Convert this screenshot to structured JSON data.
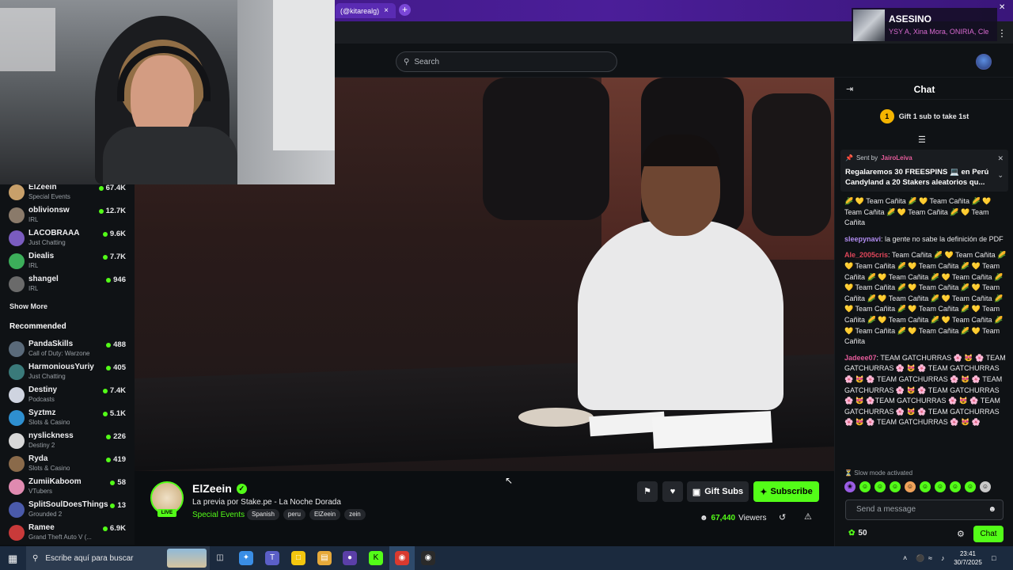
{
  "browser": {
    "tab_label": "(@kitarealg)",
    "tab_close": "×",
    "new_tab": "+"
  },
  "header": {
    "search_placeholder": "Search"
  },
  "now_playing": {
    "title": "ASESINO",
    "artists": "YSY A, Xina Mora, ONIRIA, Cle"
  },
  "sidebar": {
    "followed": [
      {
        "name": "ElZeein",
        "category": "Special Events",
        "viewers": "67.4K",
        "color": "#c8a06a"
      },
      {
        "name": "oblivionsw",
        "category": "IRL",
        "viewers": "12.7K",
        "color": "#8a7a6a"
      },
      {
        "name": "LACOBRAAA",
        "category": "Just Chatting",
        "viewers": "9.6K",
        "color": "#7a5cbf"
      },
      {
        "name": "Diealis",
        "category": "IRL",
        "viewers": "7.7K",
        "color": "#3cae5a"
      },
      {
        "name": "shangel",
        "category": "IRL",
        "viewers": "946",
        "color": "#6a6a6a"
      }
    ],
    "show_more": "Show More",
    "recommended_title": "Recommended",
    "recommended": [
      {
        "name": "PandaSkills",
        "category": "Call of Duty: Warzone",
        "viewers": "488",
        "color": "#5a6a7a"
      },
      {
        "name": "HarmoniousYuriy",
        "category": "Just Chatting",
        "viewers": "405",
        "color": "#3a7a7a"
      },
      {
        "name": "Destiny",
        "category": "Podcasts",
        "viewers": "7.4K",
        "color": "#cfd4e0"
      },
      {
        "name": "Syztmz",
        "category": "Slots & Casino",
        "viewers": "5.1K",
        "color": "#2e8fd0"
      },
      {
        "name": "nyslickness",
        "category": "Destiny 2",
        "viewers": "226",
        "color": "#d8d8d8"
      },
      {
        "name": "Ryda",
        "category": "Slots & Casino",
        "viewers": "419",
        "color": "#8a6a4a"
      },
      {
        "name": "ZumiiKaboom",
        "category": "VTubers",
        "viewers": "58",
        "color": "#e08ab0"
      },
      {
        "name": "SplitSoulDoesThings",
        "category": "Grounded 2",
        "viewers": "13",
        "color": "#4a5aaa"
      },
      {
        "name": "Ramee",
        "category": "Grand Theft Auto V (...",
        "viewers": "6.9K",
        "color": "#c83a3a"
      }
    ]
  },
  "stream": {
    "streamer": "ElZeein",
    "live": "LIVE",
    "title": "La previa por Stake.pe - La Noche Dorada",
    "category": "Special Events",
    "tags": [
      "Spanish",
      "peru",
      "ElZeein",
      "zein"
    ],
    "gift_subs": "Gift Subs",
    "subscribe": "Subscribe",
    "viewers": "67,440",
    "viewers_label": "Viewers"
  },
  "chat": {
    "title": "Chat",
    "gift_number": "1",
    "gift_promo": "Gift 1 sub to take 1st",
    "pinned_label": "Sent by",
    "pinned_user": "JairoLeiva",
    "pinned_message": "Regalaremos 30 FREESPINS 💻 en Perú Candyland a 20 Stakers aleatorios qu...",
    "messages": [
      {
        "user": "",
        "color": "#e8e8ea",
        "text": "🌽 💛 Team Cañita 🌽 💛 Team Cañita 🌽 💛 Team Cañita 🌽 💛 Team Cañita 🌽 💛 Team Cañita"
      },
      {
        "user": "sleepynavi",
        "color": "#b08cf0",
        "text": "la gente no sabe la definición de PDF"
      },
      {
        "user": "Ale_2005cris",
        "color": "#e0465a",
        "text": "Team Cañita 🌽 💛 Team Cañita 🌽 💛 Team Cañita 🌽 💛 Team Cañita 🌽 💛 Team Cañita 🌽 💛 Team Cañita 🌽 💛 Team Cañita 🌽 💛 Team Cañita 🌽 💛 Team Cañita 🌽 💛 Team Cañita 🌽 💛 Team Cañita 🌽 💛 Team Cañita 🌽 💛 Team Cañita 🌽 💛 Team Cañita 🌽 💛 Team Cañita 🌽 💛 Team Cañita 🌽 💛 Team Cañita 🌽 💛 Team Cañita 🌽 💛 Team Cañita 🌽 💛 Team Cañita"
      },
      {
        "user": "Jadeee07",
        "color": "#e45b9a",
        "text": "TEAM GATCHURRAS 🌸 😻 🌸 TEAM GATCHURRAS 🌸 😻 🌸 TEAM GATCHURRAS 🌸 😻 🌸 TEAM GATCHURRAS 🌸 😻 🌸 TEAM GATCHURRAS 🌸 😻 🌸 TEAM GATCHURRAS 🌸 😻 🌸TEAM GATCHURRAS 🌸 😻 🌸 TEAM GATCHURRAS 🌸 😻 🌸 TEAM GATCHURRAS 🌸 😻 🌸 TEAM GATCHURRAS 🌸 😻 🌸"
      }
    ],
    "slow_mode": "Slow mode activated",
    "input_placeholder": "Send a message",
    "points": "50",
    "send_button": "Chat"
  },
  "taskbar": {
    "search_placeholder": "Escribe aquí para buscar",
    "time": "23:41",
    "date": "30/7/2025"
  }
}
